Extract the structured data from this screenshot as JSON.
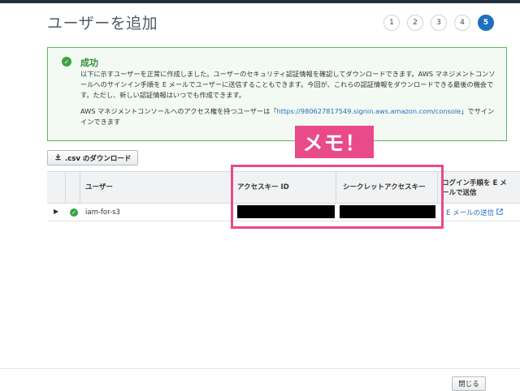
{
  "page": {
    "title": "ユーザーを追加"
  },
  "steps": [
    "1",
    "2",
    "3",
    "4",
    "5"
  ],
  "active_step": "5",
  "success": {
    "title": "成功",
    "message": "以下に示すユーザーを正常に作成しました。ユーザーのセキュリティ認証情報を確認してダウンロードできます。AWS マネジメントコンソールへのサインイン手順を E メールでユーザーに送信することもできます。今回が、これらの認証情報をダウンロードできる最後の機会です。ただし、新しい認証情報はいつでも作成できます。",
    "console_prefix": "AWS マネジメントコンソールへのアクセス権を持つユーザーは「",
    "console_url": "https://980627817549.signin.aws.amazon.com/console",
    "console_suffix": "」でサインインできます"
  },
  "memo_annotation": "メモ！",
  "toolbar": {
    "csv_download_label": ".csv のダウンロード"
  },
  "table": {
    "headers": {
      "user": "ユーザー",
      "access_key_id": "アクセスキー ID",
      "secret_access_key": "シークレットアクセスキー",
      "login_instructions": "ログイン手順を E メールで送信"
    },
    "rows": [
      {
        "user": "iam-for-s3",
        "email_action": "E メールの送信"
      }
    ]
  },
  "footer": {
    "close_label": "閉じる"
  },
  "colors": {
    "accent": "#1f6fbf",
    "success": "#3aa345",
    "highlight": "#e84a8a"
  }
}
